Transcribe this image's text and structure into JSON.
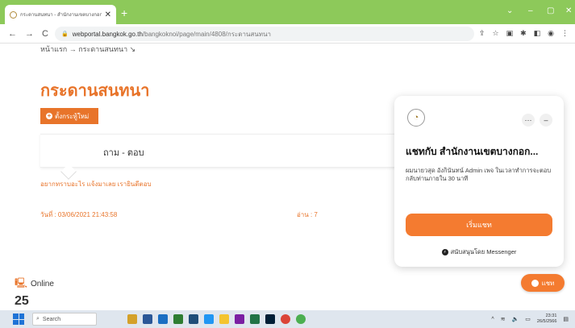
{
  "browser": {
    "tab_title": "กระดานสนทนา - สำนักงานเขตบางกอก",
    "url_domain": "webportal.bangkok.go.th",
    "url_path": "/bangkoknoi/page/main/4808/กระดานสนทนา"
  },
  "page": {
    "breadcrumb": "หน้าแรก → กระดานสนทนา ↘",
    "title": "กระดานสนทนา",
    "new_topic_label": "ตั้งกระทู้ใหม่",
    "qa_label": "ถาม - ตอบ",
    "post_question": "อยากทราบอะไร แจ้งมาเลย เรายินดีตอบ",
    "post_date": "วันที่ : 03/06/2021 21:43:58",
    "post_reads": "อ่าน : 7",
    "online_label": "Online",
    "online_count": "25"
  },
  "chat": {
    "title": "แชทกับ สำนักงานเขตบางกอก...",
    "description": "ผมนายวสุด อังกินันทน์ Admin เพจ ในเวลาทำการจะตอบกลับท่านภายใน 30 นาที",
    "start_label": "เริ่มแชท",
    "powered_by": "สนับสนุนโดย Messenger",
    "fab_label": "แชท"
  },
  "taskbar": {
    "search_placeholder": "Search",
    "time": "23:31",
    "date": "26/5/2566"
  }
}
